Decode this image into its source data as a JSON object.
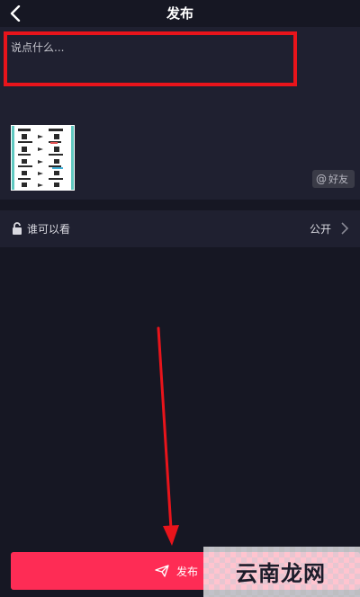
{
  "header": {
    "title": "发布",
    "back_icon": "chevron-left-icon"
  },
  "compose": {
    "caption_placeholder": "说点什么...",
    "caption_value": "",
    "mention_label": "好友",
    "mention_icon": "at-icon"
  },
  "privacy": {
    "label": "谁可以看",
    "value": "公开",
    "icon": "unlock-icon",
    "chevron_icon": "chevron-right-icon"
  },
  "publish": {
    "label": "发布",
    "icon": "send-icon"
  },
  "watermark": {
    "text": "云南龙网"
  },
  "colors": {
    "background": "#161723",
    "panel": "#1f2030",
    "accent": "#fe2c55",
    "highlight_box": "#e8141b",
    "arrow": "#e8141b"
  }
}
